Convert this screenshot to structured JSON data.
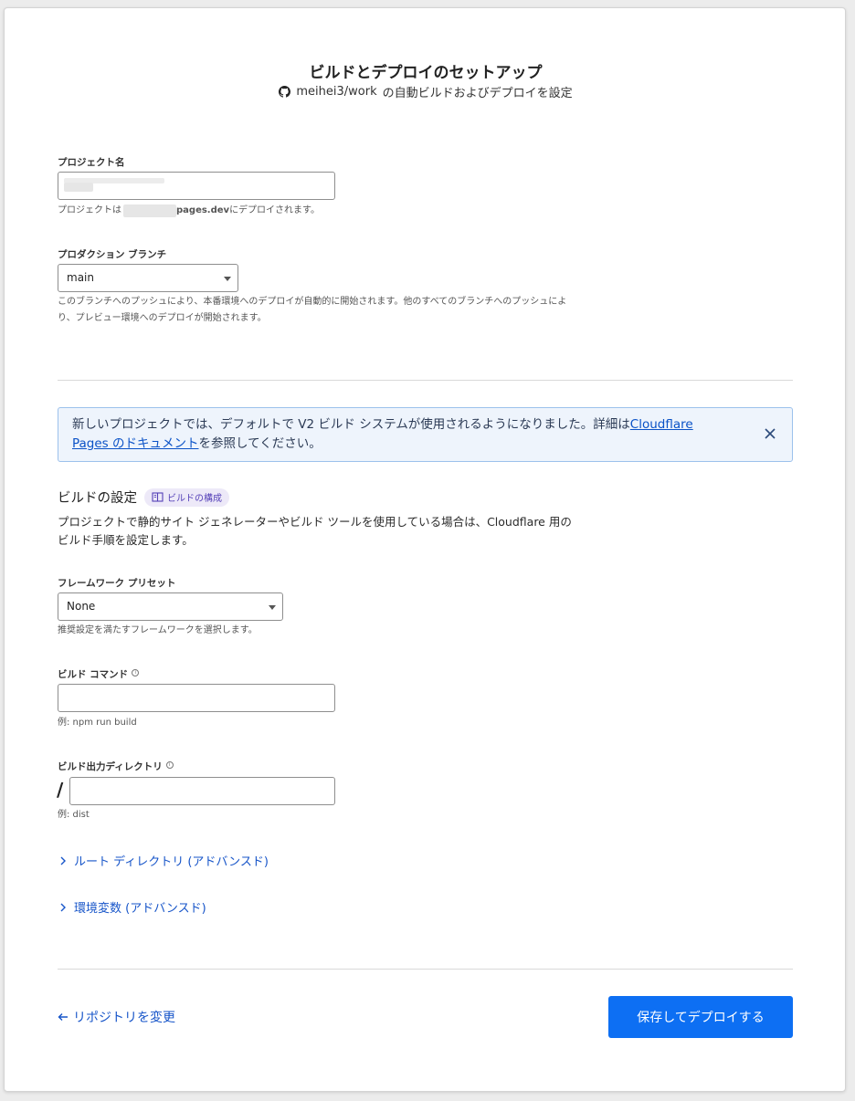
{
  "header": {
    "title": "ビルドとデプロイのセットアップ",
    "repo": "meihei3/work",
    "subtitle_suffix": "の自動ビルドおよびデプロイを設定"
  },
  "project": {
    "label": "プロジェクト名",
    "help_prefix": "プロジェクトは",
    "help_domain": "pages.dev",
    "help_suffix": "にデプロイされます。"
  },
  "branch": {
    "label": "プロダクション ブランチ",
    "value": "main",
    "help": "このブランチへのプッシュにより、本番環境へのデプロイが自動的に開始されます。他のすべてのブランチへのプッシュにより、プレビュー環境へのデプロイが開始されます。"
  },
  "banner": {
    "text_prefix": "新しいプロジェクトでは、デフォルトで V2 ビルド システムが使用されるようになりました。詳細は",
    "link": "Cloudflare Pages のドキュメント",
    "text_suffix": "を参照してください。"
  },
  "build_settings": {
    "title": "ビルドの設定",
    "pill": "ビルドの構成",
    "description": "プロジェクトで静的サイト ジェネレーターやビルド ツールを使用している場合は、Cloudflare 用のビルド手順を設定します。"
  },
  "framework": {
    "label": "フレームワーク プリセット",
    "value": "None",
    "help": "推奨設定を満たすフレームワークを選択します。"
  },
  "build_command": {
    "label": "ビルド コマンド",
    "help": "例: npm run build"
  },
  "output_dir": {
    "label": "ビルド出力ディレクトリ",
    "prefix": "/",
    "help": "例: dist"
  },
  "advanced": {
    "root_dir": "ルート ディレクトリ (アドバンスド)",
    "env_vars": "環境変数 (アドバンスド)"
  },
  "footer": {
    "back": "リポジトリを変更",
    "submit": "保存してデプロイする"
  },
  "colors": {
    "primary": "#0d6ff3",
    "link": "#1755c9",
    "banner_bg": "#eef4fc",
    "pill_bg": "#ede9f8"
  }
}
